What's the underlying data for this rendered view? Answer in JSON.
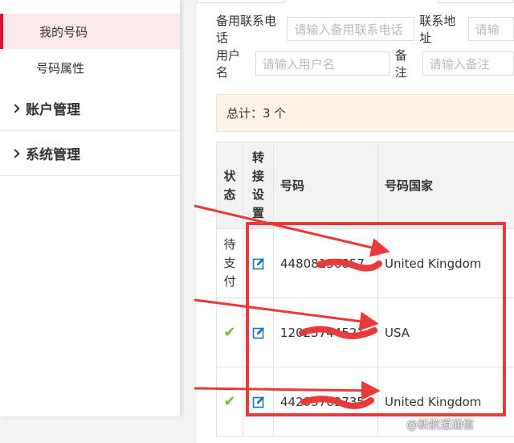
{
  "sidebar": {
    "my_numbers": "我的号码",
    "number_attr": "号码属性",
    "account_mgmt": "账户管理",
    "system_mgmt": "系统管理"
  },
  "filters": {
    "backup_phone_label": "备用联系电话",
    "backup_phone_placeholder": "请输入备用联系电话",
    "address_label": "联系地址",
    "address_placeholder": "请输",
    "username_label": "用户名",
    "username_placeholder": "请输入用户名",
    "remark_label": "备注",
    "remark_placeholder": "请输入备注"
  },
  "summary": "总计：3 个",
  "table": {
    "headers": {
      "status": "状态",
      "forward": "转接设置",
      "number": "号码",
      "country": "号码国家"
    },
    "rows": [
      {
        "status_text": "待支付",
        "number": "44808136857",
        "country": "United Kingdom"
      },
      {
        "status_icon": "check-icon",
        "number": "12023744521",
        "country": "USA"
      },
      {
        "status_icon": "check-icon",
        "number": "44203769735",
        "country": "United Kingdom"
      }
    ]
  },
  "watermark": "@新航道通信",
  "colors": {
    "accent": "#e5122b",
    "annotation": "#e83a3a",
    "check": "#6cbf2c",
    "edit": "#1a73c7"
  }
}
